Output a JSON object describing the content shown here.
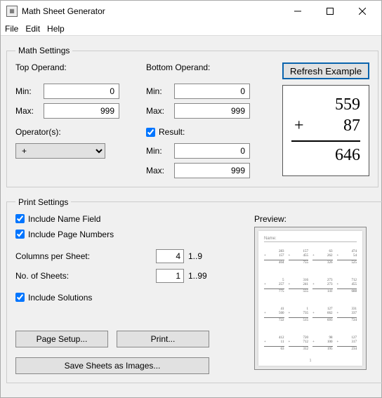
{
  "window": {
    "title": "Math Sheet Generator"
  },
  "menu": {
    "file": "File",
    "edit": "Edit",
    "help": "Help"
  },
  "math": {
    "legend": "Math Settings",
    "top_operand_label": "Top Operand:",
    "bottom_operand_label": "Bottom Operand:",
    "min_label": "Min:",
    "max_label": "Max:",
    "top_min": "0",
    "top_max": "999",
    "bottom_min": "0",
    "bottom_max": "999",
    "operator_label": "Operator(s):",
    "operator_value": "+",
    "result_label": "Result:",
    "result_checked": true,
    "result_min": "0",
    "result_max": "999",
    "refresh_label": "Refresh Example",
    "example": {
      "top": "559",
      "op": "+",
      "bottom": "87",
      "result": "646"
    }
  },
  "print": {
    "legend": "Print Settings",
    "include_name_label": "Include Name Field",
    "include_name_checked": true,
    "include_pagenum_label": "Include Page Numbers",
    "include_pagenum_checked": true,
    "columns_label": "Columns per Sheet:",
    "columns_value": "4",
    "columns_hint": "1..9",
    "sheets_label": "No. of Sheets:",
    "sheets_value": "1",
    "sheets_hint": "1..99",
    "include_solutions_label": "Include Solutions",
    "include_solutions_checked": true,
    "page_setup_label": "Page Setup...",
    "print_label": "Print...",
    "save_images_label": "Save Sheets as Images...",
    "preview_label": "Preview:",
    "preview_name": "Name:",
    "preview_pagenum": "1",
    "preview_cells": [
      {
        "a": "283",
        "b": "157",
        "c": "404"
      },
      {
        "a": "157",
        "b": "455",
        "c": "755"
      },
      {
        "a": "63",
        "b": "262",
        "c": "326"
      },
      {
        "a": "474",
        "b": "54",
        "c": "525"
      },
      {
        "a": "5",
        "b": "257",
        "c": "775"
      },
      {
        "a": "316",
        "b": "241",
        "c": "555"
      },
      {
        "a": "273",
        "b": "273",
        "c": "141"
      },
      {
        "a": "712",
        "b": "455",
        "c": "688"
      },
      {
        "a": "41",
        "b": "560",
        "c": "722"
      },
      {
        "a": "1",
        "b": "735",
        "c": "515"
      },
      {
        "a": "127",
        "b": "662",
        "c": "693"
      },
      {
        "a": "331",
        "b": "337",
        "c": "724"
      },
      {
        "a": "412",
        "b": "11",
        "c": "63"
      },
      {
        "a": "720",
        "b": "712",
        "c": "312"
      },
      {
        "a": "98",
        "b": "100",
        "c": "195"
      },
      {
        "a": "127",
        "b": "317",
        "c": "234"
      }
    ]
  }
}
